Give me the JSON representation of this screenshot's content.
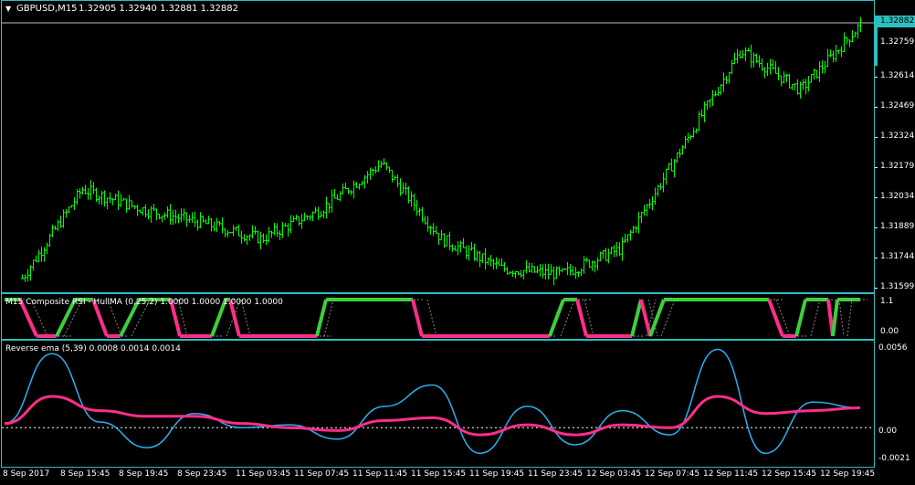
{
  "main": {
    "symbol_label": "GBPUSD,M15",
    "ohlc": "1.32905 1.32940 1.32881 1.32882",
    "price_ticks": [
      "1.32759",
      "1.32614",
      "1.32469",
      "1.32324",
      "1.32179",
      "1.32034",
      "1.31889",
      "1.31744",
      "1.31599"
    ],
    "current_price": "1.32882",
    "colors": {
      "candle": "#00ff00",
      "border": "#2bbfbf",
      "price_tag": "#2bbfbf"
    }
  },
  "rsi": {
    "title": "M15 Composite RSI - HullMA (0,25,2) 1.0000 1.0000 1.0000 1.0000",
    "ticks": [
      "1.1",
      "0.00"
    ],
    "colors": {
      "up": "#3ccf3c",
      "down": "#ff2d8a",
      "guide": "#ffffff"
    }
  },
  "ema": {
    "title": "Reverse ema (5,39) 0.0008 0.0014 0.0014",
    "ticks": [
      "0.0056",
      "0.00",
      "-0.0021"
    ],
    "colors": {
      "blue": "#2ab0f0",
      "pink": "#ff2d8a",
      "zero": "#ffffff"
    }
  },
  "time_axis": [
    "8 Sep 2017",
    "8 Sep 15:45",
    "8 Sep 19:45",
    "8 Sep 23:45",
    "11 Sep 03:45",
    "11 Sep 07:45",
    "11 Sep 11:45",
    "11 Sep 15:45",
    "11 Sep 19:45",
    "11 Sep 23:45",
    "12 Sep 03:45",
    "12 Sep 07:45",
    "12 Sep 11:45",
    "12 Sep 15:45",
    "12 Sep 19:45"
  ],
  "chart_data": [
    {
      "type": "candlestick",
      "title": "GBPUSD,M15",
      "ylim": [
        1.3153,
        1.33
      ],
      "x": [
        "8 Sep 2017",
        "8 Sep 15:45",
        "8 Sep 19:45",
        "8 Sep 23:45",
        "11 Sep 03:45",
        "11 Sep 07:45",
        "11 Sep 11:45",
        "11 Sep 15:45",
        "11 Sep 19:45",
        "11 Sep 23:45",
        "12 Sep 03:45",
        "12 Sep 07:45",
        "12 Sep 11:45",
        "12 Sep 15:45",
        "12 Sep 19:45"
      ],
      "close_approx": [
        1.316,
        1.3205,
        1.3195,
        1.3188,
        1.318,
        1.3195,
        1.3218,
        1.318,
        1.3165,
        1.3162,
        1.3175,
        1.3225,
        1.3275,
        1.3255,
        1.3288
      ]
    },
    {
      "type": "line",
      "title": "Reverse ema (5,39)",
      "ylim": [
        -0.0021,
        0.0056
      ],
      "series": [
        {
          "values": [
            0.0003,
            0.0052,
            0.0004,
            -0.0014,
            0.001,
            0.0,
            0.0002,
            -0.0008,
            0.0015,
            0.003,
            -0.0018,
            0.0015,
            -0.0012,
            0.0012,
            -0.0005,
            0.0055,
            -0.0018,
            0.0018,
            0.0014
          ]
        },
        {
          "values": [
            0.0003,
            0.0022,
            0.0012,
            0.0008,
            0.0008,
            0.0003,
            0.0,
            -0.0002,
            0.0005,
            0.0007,
            -0.0005,
            0.0002,
            -0.0005,
            0.0002,
            0.0,
            0.0022,
            0.001,
            0.0012,
            0.0014
          ]
        }
      ]
    }
  ]
}
